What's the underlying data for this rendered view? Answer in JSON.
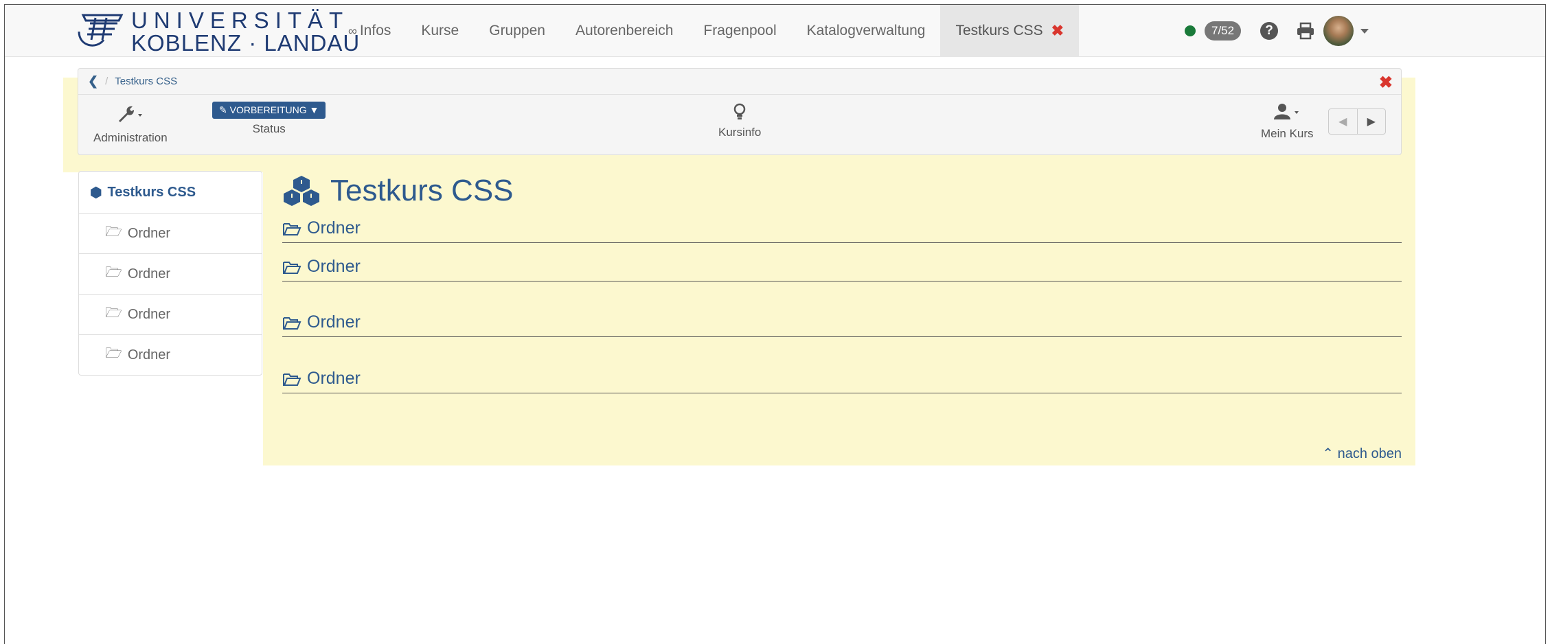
{
  "logo": {
    "line1": "UNIVERSITÄT",
    "line2": "KOBLENZ · LANDAU"
  },
  "nav": {
    "items": [
      "Infos",
      "Kurse",
      "Gruppen",
      "Autorenbereich",
      "Fragenpool",
      "Katalogverwaltung"
    ],
    "infos_prefix": "∞",
    "active_tab": "Testkurs CSS",
    "active_close": "✖",
    "counter": "7/52",
    "help": "?"
  },
  "breadcrumb": {
    "back": "❮",
    "separator": "/",
    "current": "Testkurs CSS",
    "close": "✖"
  },
  "toolbar": {
    "administration": "Administration",
    "status_button": "VORBEREITUNG",
    "status": "Status",
    "kursinfo": "Kursinfo",
    "mein_kurs": "Mein Kurs"
  },
  "sidebar": {
    "title": "Testkurs CSS",
    "items": [
      "Ordner",
      "Ordner",
      "Ordner",
      "Ordner"
    ]
  },
  "main": {
    "title": "Testkurs CSS",
    "folders": [
      "Ordner",
      "Ordner",
      "Ordner",
      "Ordner"
    ],
    "to_top": "nach oben"
  },
  "colors": {
    "accent": "#2e5a8e",
    "highlight": "#fcf8cf",
    "close": "#d9362e",
    "online": "#1a7a3a"
  }
}
